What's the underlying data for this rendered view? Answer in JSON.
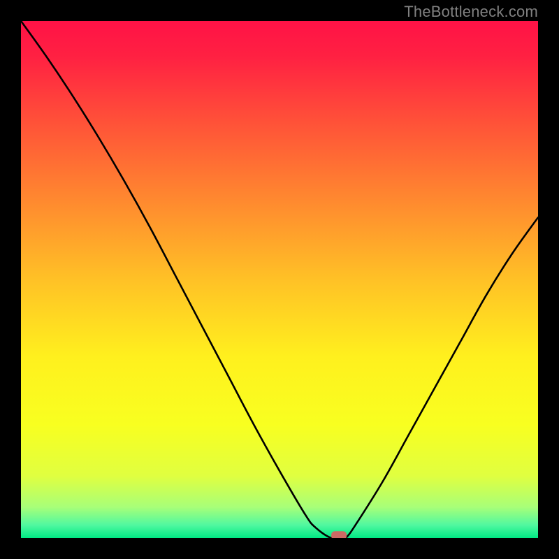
{
  "watermark": {
    "text": "TheBottleneck.com"
  },
  "chart_data": {
    "type": "line",
    "title": "",
    "xlabel": "",
    "ylabel": "",
    "xlim": [
      0,
      100
    ],
    "ylim": [
      0,
      100
    ],
    "x": [
      0,
      5,
      10,
      15,
      20,
      25,
      30,
      35,
      40,
      45,
      50,
      55,
      57,
      60,
      62,
      63,
      65,
      70,
      75,
      80,
      85,
      90,
      95,
      100
    ],
    "values": [
      100,
      93,
      85.5,
      77.5,
      69,
      60,
      50.5,
      41,
      31.5,
      22,
      13,
      4.5,
      2,
      0,
      0,
      0.2,
      3,
      11,
      20,
      29,
      38,
      47,
      55,
      62
    ],
    "optimum_marker": {
      "x": 61.5,
      "y": 0.5
    },
    "gradient_stops": [
      {
        "offset": 0.0,
        "color": "#ff1246"
      },
      {
        "offset": 0.07,
        "color": "#ff2142"
      },
      {
        "offset": 0.2,
        "color": "#ff5338"
      },
      {
        "offset": 0.35,
        "color": "#ff8a2f"
      },
      {
        "offset": 0.5,
        "color": "#ffc126"
      },
      {
        "offset": 0.65,
        "color": "#fff01e"
      },
      {
        "offset": 0.78,
        "color": "#f8ff20"
      },
      {
        "offset": 0.88,
        "color": "#e0ff40"
      },
      {
        "offset": 0.94,
        "color": "#a8ff78"
      },
      {
        "offset": 0.975,
        "color": "#50f8a0"
      },
      {
        "offset": 1.0,
        "color": "#00e884"
      }
    ]
  }
}
